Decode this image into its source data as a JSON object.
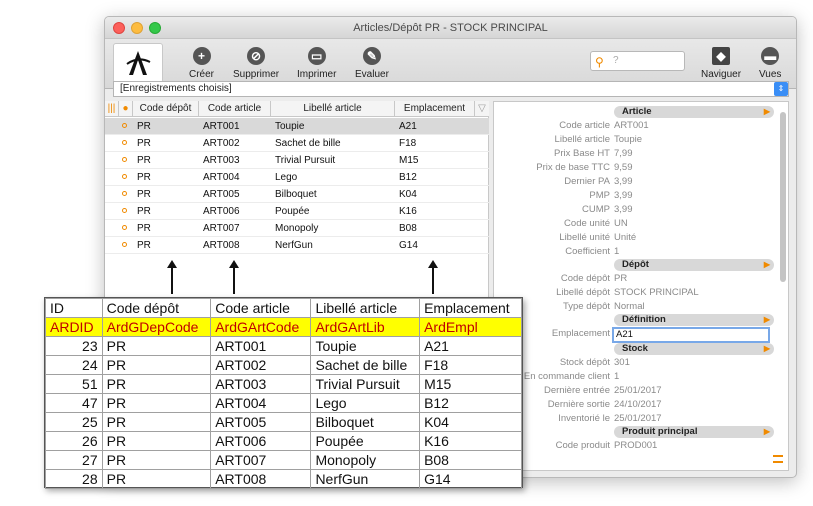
{
  "window": {
    "title": "Articles/Dépôt PR - STOCK PRINCIPAL"
  },
  "toolbar": {
    "creer": "Créer",
    "supprimer": "Supprimer",
    "imprimer": "Imprimer",
    "evaluer": "Evaluer",
    "search_placeholder": "?",
    "naviguer": "Naviguer",
    "vues": "Vues"
  },
  "selector": {
    "value": "[Enregistrements choisis]"
  },
  "grid": {
    "columns": [
      "Code dépôt",
      "Code article",
      "Libellé article",
      "Emplacement"
    ],
    "rows": [
      {
        "depot": "PR",
        "article": "ART001",
        "libelle": "Toupie",
        "empl": "A21"
      },
      {
        "depot": "PR",
        "article": "ART002",
        "libelle": "Sachet de bille",
        "empl": "F18"
      },
      {
        "depot": "PR",
        "article": "ART003",
        "libelle": "Trivial Pursuit",
        "empl": "M15"
      },
      {
        "depot": "PR",
        "article": "ART004",
        "libelle": "Lego",
        "empl": "B12"
      },
      {
        "depot": "PR",
        "article": "ART005",
        "libelle": "Bilboquet",
        "empl": "K04"
      },
      {
        "depot": "PR",
        "article": "ART006",
        "libelle": "Poupée",
        "empl": "K16"
      },
      {
        "depot": "PR",
        "article": "ART007",
        "libelle": "Monopoly",
        "empl": "B08"
      },
      {
        "depot": "PR",
        "article": "ART008",
        "libelle": "NerfGun",
        "empl": "G14"
      }
    ]
  },
  "detail": {
    "sections": {
      "article": "Article",
      "depot": "Dépôt",
      "definition": "Définition",
      "stock": "Stock",
      "produit": "Produit principal"
    },
    "fields": [
      {
        "label": "Code article",
        "value": "ART001"
      },
      {
        "label": "Libellé article",
        "value": "Toupie"
      },
      {
        "label": "Prix Base HT",
        "value": "7,99"
      },
      {
        "label": "Prix de base TTC",
        "value": "9,59"
      },
      {
        "label": "Dernier PA",
        "value": "3,99"
      },
      {
        "label": "PMP",
        "value": "3,99"
      },
      {
        "label": "CUMP",
        "value": "3,99"
      },
      {
        "label": "Code unité",
        "value": "UN"
      },
      {
        "label": "Libellé unité",
        "value": "Unité"
      },
      {
        "label": "Coefficient",
        "value": "1"
      },
      {
        "label": "Code dépôt",
        "value": "PR"
      },
      {
        "label": "Libellé dépôt",
        "value": "STOCK PRINCIPAL"
      },
      {
        "label": "Type dépôt",
        "value": "Normal"
      },
      {
        "label": "Emplacement",
        "value": "A21"
      },
      {
        "label": "Stock dépôt",
        "value": "301"
      },
      {
        "label": "En commande client",
        "value": "1"
      },
      {
        "label": "Dernière entrée",
        "value": "25/01/2017"
      },
      {
        "label": "Dernière sortie",
        "value": "24/10/2017"
      },
      {
        "label": "Inventorié le",
        "value": "25/01/2017"
      },
      {
        "label": "Code produit",
        "value": "PROD001"
      }
    ]
  },
  "sql_table": {
    "headers": [
      "ID",
      "Code dépôt",
      "Code article",
      "Libellé article",
      "Emplacement"
    ],
    "fieldnames": [
      "ARDID",
      "ArdGDepCode",
      "ArdGArtCode",
      "ArdGArtLib",
      "ArdEmpl"
    ],
    "rows": [
      [
        "23",
        "PR",
        "ART001",
        "Toupie",
        "A21"
      ],
      [
        "24",
        "PR",
        "ART002",
        "Sachet de bille",
        "F18"
      ],
      [
        "51",
        "PR",
        "ART003",
        "Trivial Pursuit",
        "M15"
      ],
      [
        "47",
        "PR",
        "ART004",
        "Lego",
        "B12"
      ],
      [
        "25",
        "PR",
        "ART005",
        "Bilboquet",
        "K04"
      ],
      [
        "26",
        "PR",
        "ART006",
        "Poupée",
        "K16"
      ],
      [
        "27",
        "PR",
        "ART007",
        "Monopoly",
        "B08"
      ],
      [
        "28",
        "PR",
        "ART008",
        "NerfGun",
        "G14"
      ]
    ]
  },
  "colors": {
    "accent": "#f08a00",
    "highlight": "#ffff00",
    "fieldname_text": "#c00000"
  }
}
